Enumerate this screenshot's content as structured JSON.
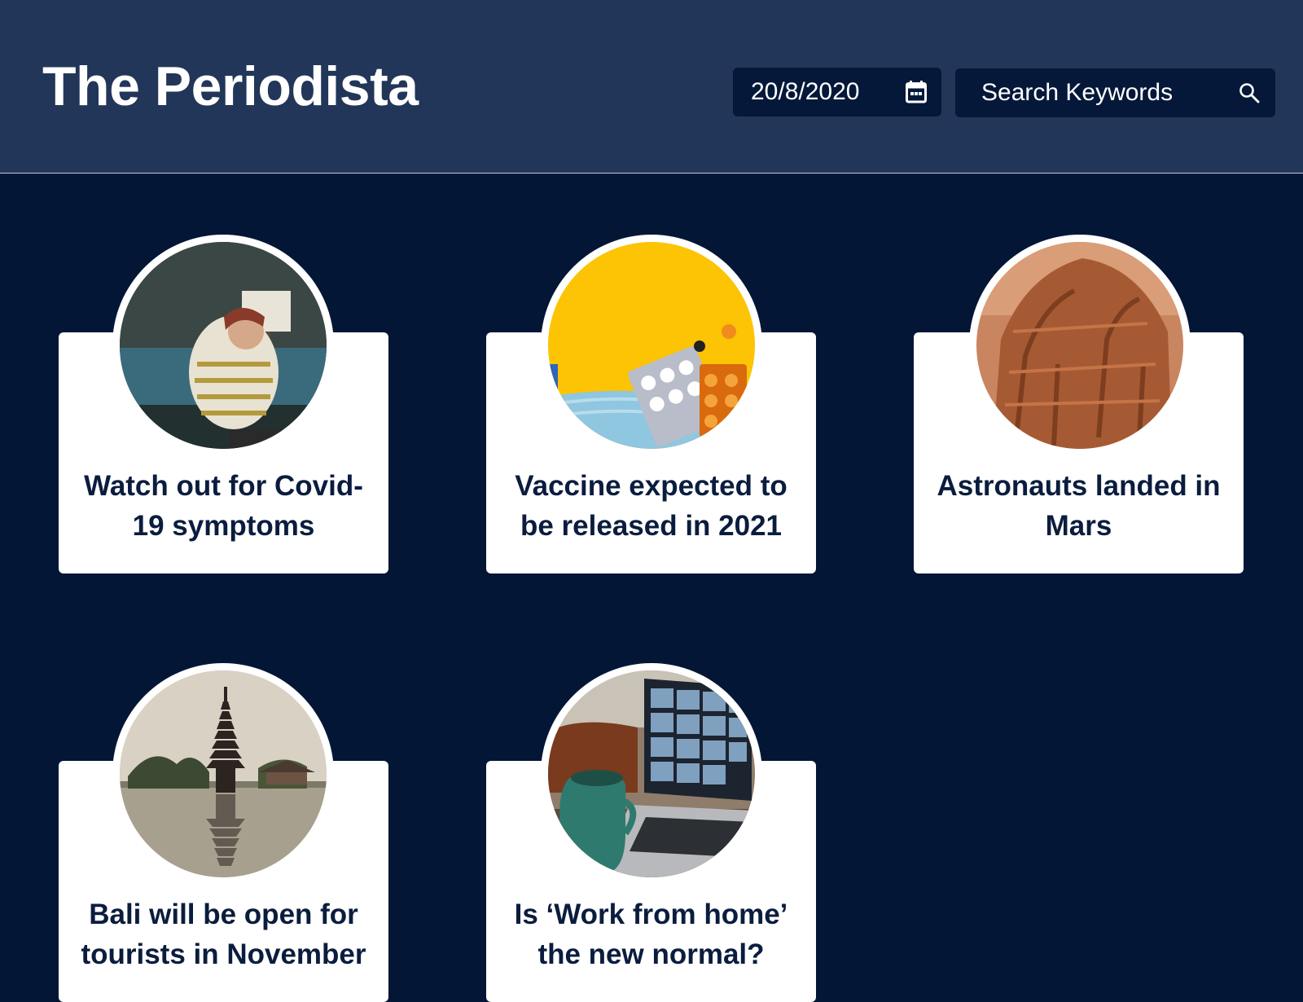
{
  "header": {
    "title": "The Periodista",
    "date": "20/8/2020",
    "date_icon": "calendar-icon",
    "search_placeholder": "Search Keywords",
    "search_icon": "search-icon"
  },
  "articles": [
    {
      "title": "Watch out for Covid-19 symptoms",
      "image": "woman-coughing-on-sofa"
    },
    {
      "title": "Vaccine expected to be released in 2021",
      "image": "pills-and-face-mask"
    },
    {
      "title": "Astronauts landed in Mars",
      "image": "red-rock-formation"
    },
    {
      "title": "Bali will be open for tourists in November",
      "image": "bali-water-temple"
    },
    {
      "title": "Is ‘Work from home’ the new normal?",
      "image": "laptop-video-call"
    }
  ],
  "colors": {
    "header_bg": "#223659",
    "page_bg": "#031636",
    "input_bg": "#051839",
    "card_bg": "#ffffff",
    "title_text": "#0b1d3e"
  }
}
